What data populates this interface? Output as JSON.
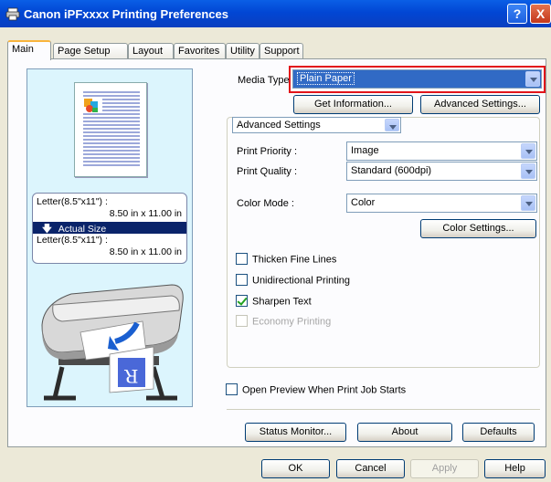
{
  "window": {
    "title": "Canon iPFxxxx Printing Preferences",
    "help_label": "?",
    "close_label": "X"
  },
  "tabs": [
    {
      "label": "Main",
      "active": true
    },
    {
      "label": "Page Setup"
    },
    {
      "label": "Layout"
    },
    {
      "label": "Favorites"
    },
    {
      "label": "Utility"
    },
    {
      "label": "Support"
    }
  ],
  "preview": {
    "original_size": "Letter(8.5\"x11\") :",
    "original_dims": "8.50 in x 11.00 in",
    "scaling_label": "Actual Size",
    "output_size": "Letter(8.5\"x11\") :",
    "output_dims": "8.50 in x 11.00 in",
    "sheet_letter": "R"
  },
  "media": {
    "label": "Media Type :",
    "value": "Plain Paper",
    "get_information_label": "Get Information...",
    "advanced_settings_label": "Advanced Settings..."
  },
  "settings": {
    "mode_value": "Advanced Settings",
    "print_priority_label": "Print Priority :",
    "print_priority_value": "Image",
    "print_quality_label": "Print Quality :",
    "print_quality_value": "Standard (600dpi)",
    "color_mode_label": "Color Mode :",
    "color_mode_value": "Color",
    "color_settings_label": "Color Settings..."
  },
  "options": [
    {
      "label": "Thicken Fine Lines",
      "checked": false,
      "enabled": true
    },
    {
      "label": "Unidirectional Printing",
      "checked": false,
      "enabled": true
    },
    {
      "label": "Sharpen Text",
      "checked": true,
      "enabled": true
    },
    {
      "label": "Economy Printing",
      "checked": false,
      "enabled": false
    }
  ],
  "open_preview_label": "Open Preview When Print Job Starts",
  "bottom_buttons": {
    "status_monitor": "Status Monitor...",
    "about": "About",
    "defaults": "Defaults"
  },
  "dialog_buttons": {
    "ok": "OK",
    "cancel": "Cancel",
    "apply": "Apply",
    "help": "Help"
  },
  "colors": {
    "highlight_border": "#e2141a",
    "preview_bg": "#dcf5fd",
    "titlebar": "#0146d4"
  }
}
